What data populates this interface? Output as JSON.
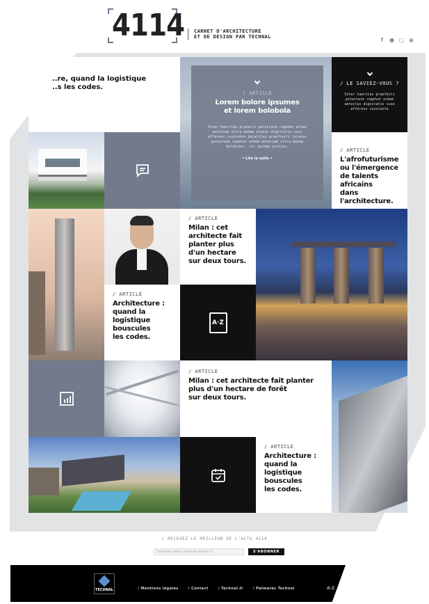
{
  "header": {
    "logo_number": "4114",
    "tagline_line1": "CARNET D'ARCHITECTURE",
    "tagline_line2": "ET DE DESIGN PAR TECHNAL",
    "social_icons": [
      "facebook-icon",
      "twitter-icon",
      "instagram-icon",
      "pinterest-icon"
    ]
  },
  "tiles": {
    "partial_article": {
      "text_line1": "..re, quand la logistique",
      "text_line2": "..s les codes."
    },
    "hero": {
      "kicker": "/ ARTICLE",
      "title_line1": "Lorem bolore ipsumes",
      "title_line2": "et lorem bolobola",
      "body": "Inter haeritas prunecti potestate regehat arbem aeternam ultra medam elaten dignitatis suse efferens insolente datalitas praeftecti lorenus potestate regehat arbem aeternam ultra medum delatoier. vir quidam prolius.",
      "cta": "• Lire la suite •"
    },
    "saviez_vous": {
      "kicker": "/ LE SAVIEZ-VOUS ?",
      "body": "Inter haeritas praefecti potestate regehat arbem aeteitas dignitatis suse efferens insolente"
    },
    "afro": {
      "kicker": "/ ARTICLE",
      "title_line1": "L'afrofuturisme",
      "title_line2": "ou l'émergence",
      "title_line3": "de talents africains",
      "title_line4": "dans l'architecture."
    },
    "milan_short": {
      "kicker": "/ ARTICLE",
      "title_line1": "Milan : cet",
      "title_line2": "architecte fait",
      "title_line3": "planter plus",
      "title_line4": "d'un hectare",
      "title_line5": "sur deux tours."
    },
    "archi_1": {
      "kicker": "/ ARTICLE",
      "title_line1": "Architecture :",
      "title_line2": "quand la logistique",
      "title_line3": "bouscules",
      "title_line4": "les codes."
    },
    "az_label": "A·Z",
    "milan_long": {
      "kicker": "/ ARTICLE",
      "title_line1": "Milan : cet architecte fait planter",
      "title_line2": "plus d'un hectare de forêt",
      "title_line3": "sur deux tours."
    },
    "archi_2": {
      "kicker": "/ ARTICLE",
      "title_line1": "Architecture :",
      "title_line2": "quand la logistique",
      "title_line3": "bouscules",
      "title_line4": "les codes."
    }
  },
  "newsletter": {
    "label": "/ RECEVEZ LE MEILLEUR DE L'ACTU 4114",
    "placeholder": "Saisissez votre adresse email ici",
    "button": "S'ABONNER"
  },
  "footer": {
    "brand": "TECHNAL",
    "links": [
      "/ Mentions légales",
      "/ Contact",
      "/ Technal.fr",
      "/ Palmarès Technal"
    ],
    "az": "A·Z"
  },
  "colors": {
    "slate": "#727a8c",
    "black": "#111111",
    "gray_bg": "#e2e3e5"
  }
}
